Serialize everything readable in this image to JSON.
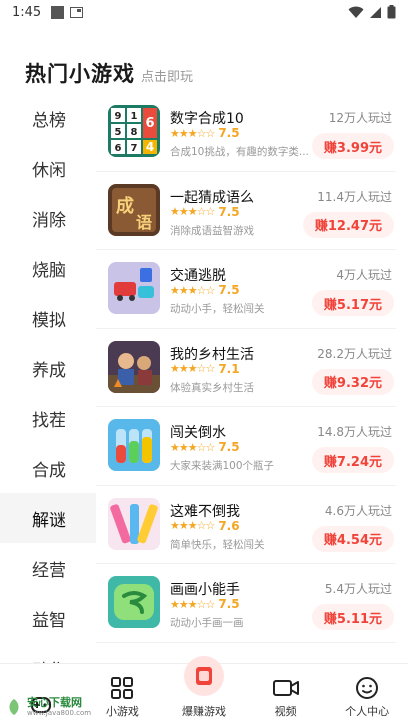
{
  "status": {
    "time": "1:45"
  },
  "header": {
    "title": "热门小游戏",
    "subtitle": "点击即玩"
  },
  "sidebar": {
    "items": [
      {
        "label": "总榜",
        "active": false
      },
      {
        "label": "休闲",
        "active": false
      },
      {
        "label": "消除",
        "active": false
      },
      {
        "label": "烧脑",
        "active": false
      },
      {
        "label": "模拟",
        "active": false
      },
      {
        "label": "养成",
        "active": false
      },
      {
        "label": "找茬",
        "active": false
      },
      {
        "label": "合成",
        "active": false
      },
      {
        "label": "解谜",
        "active": true
      },
      {
        "label": "经营",
        "active": false
      },
      {
        "label": "益智",
        "active": false
      },
      {
        "label": "动作",
        "active": false
      }
    ]
  },
  "games": [
    {
      "name": "数字合成10",
      "stars": 3.5,
      "score": "7.5",
      "desc": "合成10挑战，有趣的数字类...",
      "players": "12万人玩过",
      "earn": "赚3.99元",
      "icon": "number-merge-icon"
    },
    {
      "name": "一起猜成语么",
      "stars": 3.5,
      "score": "7.5",
      "desc": "消除成语益智游戏",
      "players": "11.4万人玩过",
      "earn": "赚12.47元",
      "icon": "idiom-icon"
    },
    {
      "name": "交通逃脱",
      "stars": 3.5,
      "score": "7.5",
      "desc": "动动小手，轻松闯关",
      "players": "4万人玩过",
      "earn": "赚5.17元",
      "icon": "traffic-icon"
    },
    {
      "name": "我的乡村生活",
      "stars": 3.5,
      "score": "7.1",
      "desc": "体验真实乡村生活",
      "players": "28.2万人玩过",
      "earn": "赚9.32元",
      "icon": "village-icon"
    },
    {
      "name": "闯关倒水",
      "stars": 3.5,
      "score": "7.5",
      "desc": "大家来装满100个瓶子",
      "players": "14.8万人玩过",
      "earn": "赚7.24元",
      "icon": "pour-water-icon"
    },
    {
      "name": "这难不倒我",
      "stars": 3.5,
      "score": "7.6",
      "desc": "简单快乐，轻松闯关",
      "players": "4.6万人玩过",
      "earn": "赚4.54元",
      "icon": "puzzle-icon"
    },
    {
      "name": "画画小能手",
      "stars": 3.5,
      "score": "7.5",
      "desc": "动动小手画一画",
      "players": "5.4万人玩过",
      "earn": "赚5.11元",
      "icon": "drawing-icon"
    }
  ],
  "nav": [
    {
      "label": "",
      "icon": "gamepad-icon"
    },
    {
      "label": "小游戏",
      "icon": "grid-icon"
    },
    {
      "label": "爆赚游戏",
      "icon": "money-icon"
    },
    {
      "label": "视频",
      "icon": "video-icon"
    },
    {
      "label": "个人中心",
      "icon": "smile-icon"
    }
  ],
  "watermark": {
    "text": "安心下载网",
    "url": "www.Java800.com"
  }
}
